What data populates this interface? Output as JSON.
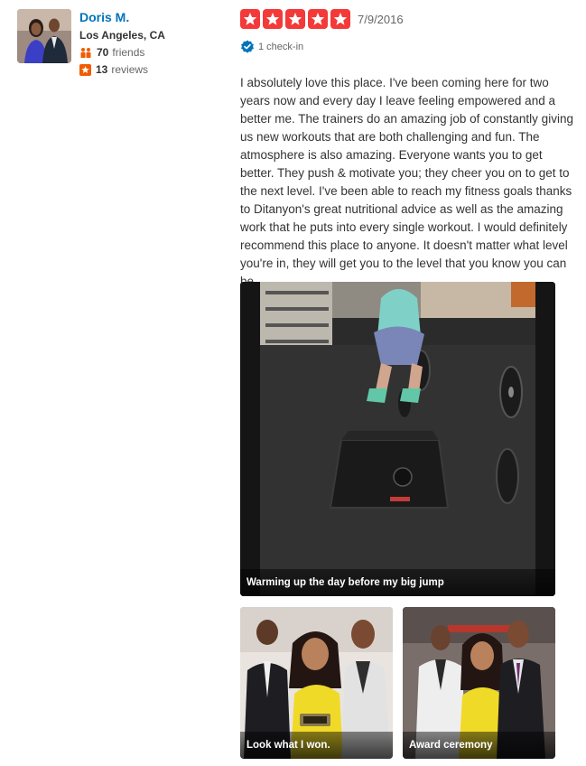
{
  "user": {
    "name": "Doris M.",
    "location": "Los Angeles, CA",
    "friends_count": "70",
    "friends_label": "friends",
    "reviews_count": "13",
    "reviews_label": "reviews"
  },
  "review": {
    "rating": 5,
    "date": "7/9/2016",
    "checkin_text": "1 check-in",
    "text": "I absolutely love this place. I've been coming here for two years now and every day I leave feeling empowered and a better me. The trainers do an amazing job of constantly giving us new workouts that are both challenging and fun. The atmosphere is also amazing. Everyone wants you to get better. They push & motivate you; they cheer you on to get to the next level. I've been able to reach my fitness goals thanks to Ditanyon's great nutritional advice as well as the amazing work that he puts into every single workout. I would definitely recommend this place to anyone. It doesn't matter what level you're in, they will get you to the level that you know you can be."
  },
  "photos": [
    {
      "caption": "Warming up the day before my big jump"
    },
    {
      "caption": "Look what I won."
    },
    {
      "caption": "Award ceremony"
    }
  ],
  "colors": {
    "user_link": "#0073bb",
    "star_red": "#f43939",
    "friends_icon": "#f15c00",
    "reviews_icon": "#f15c00",
    "checkin_badge": "#0073bb"
  }
}
